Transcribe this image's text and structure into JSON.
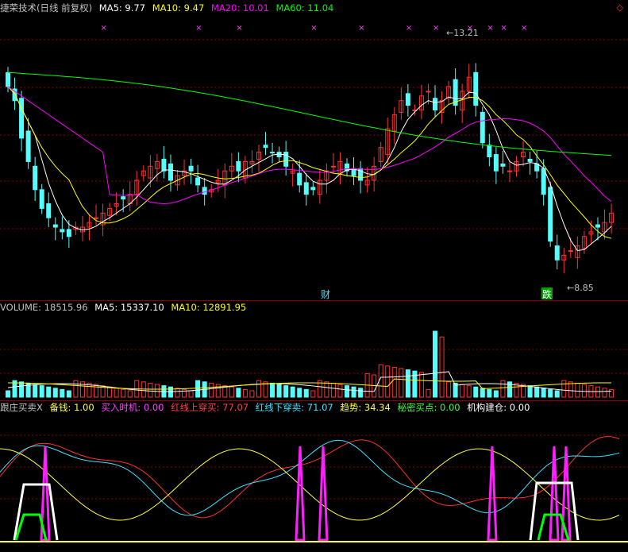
{
  "header": {
    "title": "捷荣技术(日线 前复权)",
    "ma5": "MA5: 9.77",
    "ma10": "MA10: 9.47",
    "ma20": "MA20: 10.01",
    "ma60": "MA60: 11.04",
    "corner_icon": "diamond-icon"
  },
  "volume_header": {
    "label": "VOLUME: 18515.96",
    "ma5": "MA5: 15337.10",
    "ma10": "MA10: 12891.95"
  },
  "indicator_header": {
    "name": "跟庄买卖X",
    "items": [
      {
        "label": "备钱: 1.00",
        "color": "#ffff40"
      },
      {
        "label": "买入时机: 0.00",
        "color": "#ff40ff"
      },
      {
        "label": "红线上穿买: 77.07",
        "color": "#ff4040"
      },
      {
        "label": "红线下穿卖: 71.07",
        "color": "#40e0ff"
      },
      {
        "label": "趋势: 34.34",
        "color": "#ffff40"
      },
      {
        "label": "秘密买点: 0.00",
        "color": "#40ff40"
      },
      {
        "label": "机构建仓: 0.00",
        "color": "#ffffff"
      }
    ]
  },
  "chart_data": {
    "type": "candlestick",
    "high_label": "13.21",
    "low_label": "8.85",
    "markers": [
      {
        "text": "财",
        "color": "#40e0ff"
      },
      {
        "text": "跌",
        "color": "#40ff40"
      }
    ],
    "signal_mark": "×",
    "colors": {
      "up": "#ff3232",
      "down": "#54fcfc",
      "ma5": "#ffffff",
      "ma10": "#ffff00",
      "ma20": "#ff00ff",
      "ma60": "#00ff00",
      "grid": "#8b0000"
    }
  }
}
